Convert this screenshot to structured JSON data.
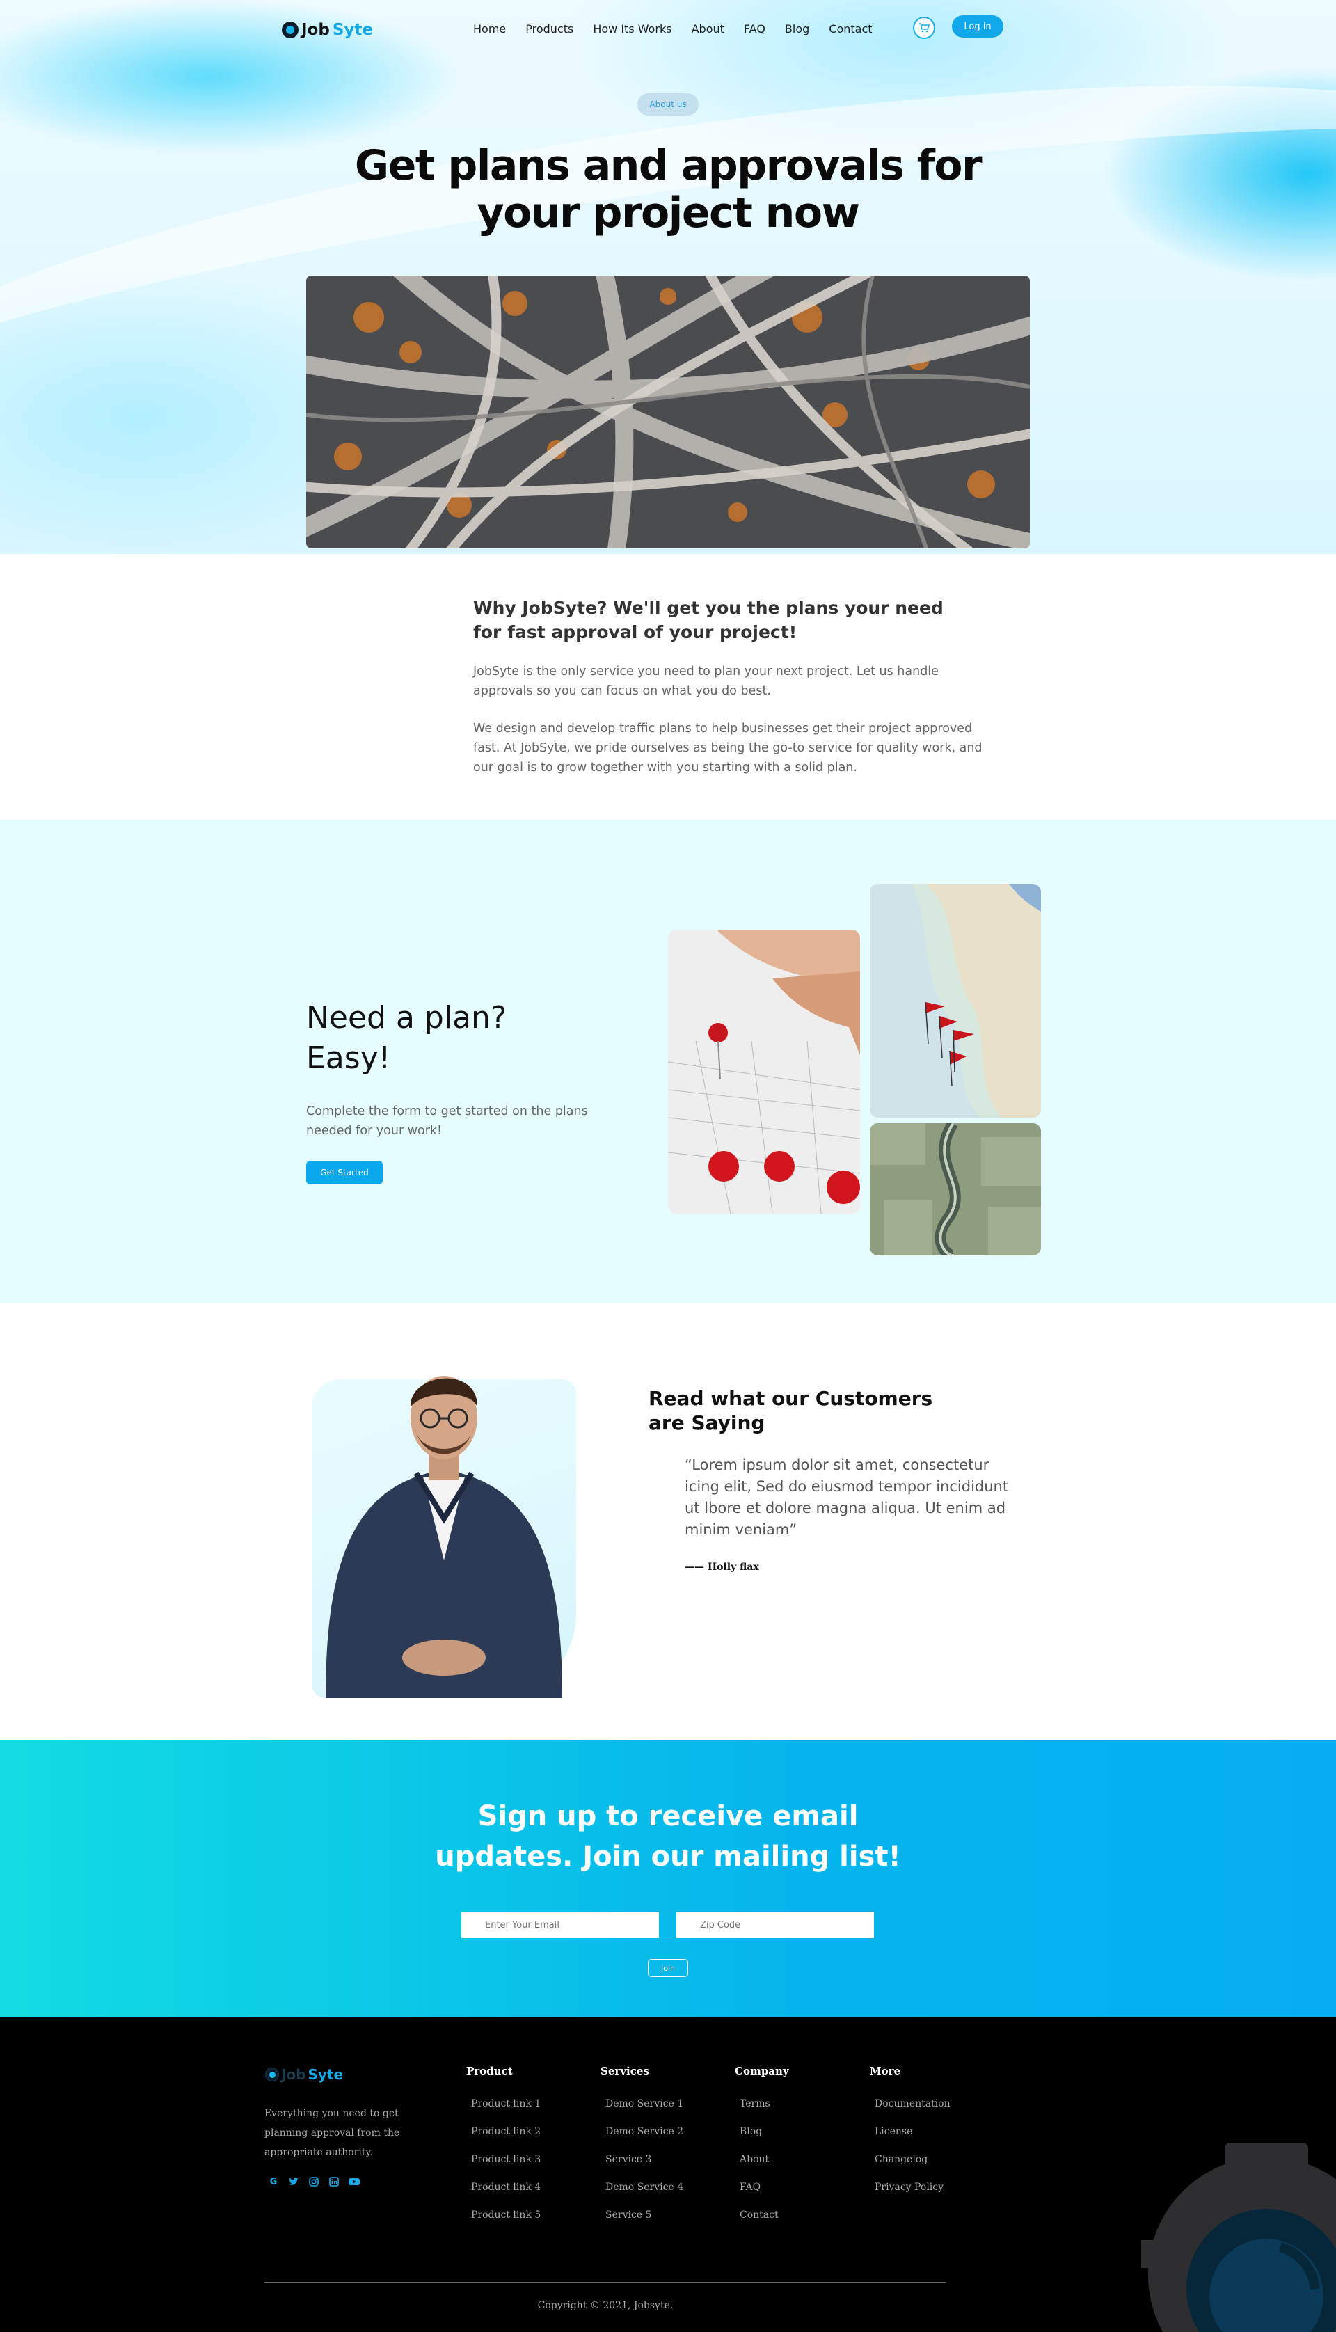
{
  "nav": {
    "logo_job": "Job",
    "logo_syte": "Syte",
    "links": [
      "Home",
      "Products",
      "How Its Works",
      "About",
      "FAQ",
      "Blog",
      "Contact"
    ],
    "login_label": "Log in"
  },
  "hero": {
    "pill": "About us",
    "title_line1": "Get plans and approvals for",
    "title_line2": "your project now"
  },
  "intro": {
    "heading": "Why JobSyte? We'll get you the plans your need for fast approval of your project!",
    "p1": "JobSyte is the only service you need to plan your next project. Let us handle approvals so you can focus on what you do best.",
    "p2": "We design and develop traffic plans to help businesses get their project approved fast. At JobSyte, we pride ourselves as being the go-to service for quality work, and our goal is to grow together with you starting with a solid plan."
  },
  "plan": {
    "heading_line1": "Need a plan?",
    "heading_line2": "Easy!",
    "text": "Complete the form to get started on the plans needed for your work!",
    "button": "Get Started"
  },
  "testimonial": {
    "heading": "Read what our Customers are Saying",
    "quote": "“Lorem ipsum dolor sit amet, consectetur icing elit, Sed do eiusmod tempor incididunt ut lbore et dolore magna aliqua. Ut enim ad minim veniam”",
    "author": "—— Holly flax"
  },
  "signup": {
    "title_line1": "Sign up to receive email",
    "title_line2": "updates. Join our mailing list!",
    "email_placeholder": "Enter Your Email",
    "zip_placeholder": "Zip Code",
    "join": "Join"
  },
  "footer": {
    "about": "Everything you need to get planning approval from the appropriate authority.",
    "socials": [
      "google-icon",
      "twitter-icon",
      "instagram-icon",
      "linkedin-icon",
      "youtube-icon"
    ],
    "columns": {
      "product": {
        "title": "Product",
        "links": [
          "Product link 1",
          "Product link 2",
          "Product link 3",
          "Product link 4",
          "Product link 5"
        ]
      },
      "services": {
        "title": "Services",
        "links": [
          "Demo Service 1",
          "Demo Service 2",
          "Service 3",
          "Demo Service 4",
          "Service 5"
        ]
      },
      "company": {
        "title": "Company",
        "links": [
          "Terms",
          "Blog",
          "About",
          "FAQ",
          "Contact"
        ]
      },
      "more": {
        "title": "More",
        "links": [
          "Documentation",
          "License",
          "Changelog",
          "Privacy Policy"
        ]
      }
    },
    "copyright": "Copyright © 2021, Jobsyte."
  },
  "colors": {
    "accent": "#11a8eb",
    "plan_bg": "#e6fdff",
    "footer_bg": "#000000"
  }
}
